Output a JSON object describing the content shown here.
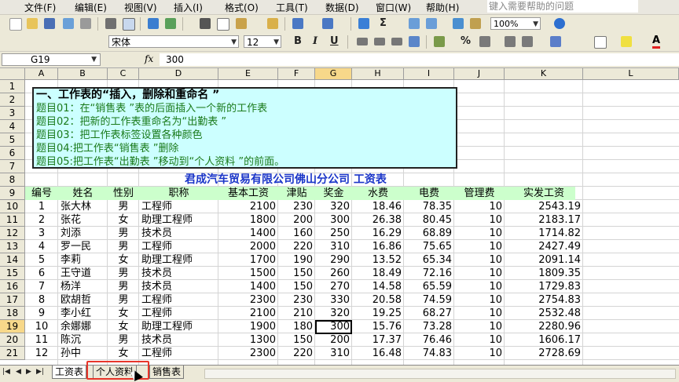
{
  "menu": [
    "文件(F)",
    "编辑(E)",
    "视图(V)",
    "插入(I)",
    "格式(O)",
    "工具(T)",
    "数据(D)",
    "窗口(W)",
    "帮助(H)"
  ],
  "help_placeholder": "键入需要帮助的问题",
  "font": {
    "name": "宋体",
    "size": "12"
  },
  "zoom": "100%",
  "formula_bar": {
    "cell_ref": "G19",
    "fx": "fx",
    "value": "300"
  },
  "columns": [
    "A",
    "B",
    "C",
    "D",
    "E",
    "F",
    "G",
    "H",
    "I",
    "J",
    "K",
    "L"
  ],
  "selected_column": "G",
  "rows": [
    "1",
    "2",
    "3",
    "4",
    "5",
    "6",
    "7",
    "8",
    "9",
    "10",
    "11",
    "12",
    "13",
    "14",
    "15",
    "16",
    "17",
    "18",
    "19",
    "20",
    "21"
  ],
  "selected_row": "19",
  "instructions": {
    "title": "一、工作表的“插入，删除和重命名 ”",
    "items": [
      "题目01：在“销售表 ”表的后面插入一个新的工作表",
      "题目02：把新的工作表重命名为“出勤表 ”",
      "题目03：把工作表标签设置各种颜色",
      "题目04:把工作表“销售表 ”删除",
      "题目05:把工作表“出勤表 ”移动到“个人资料 ”的前面。"
    ]
  },
  "company_title": "君成汽车贸易有限公司佛山分公司    工资表",
  "table_headers": [
    "编号",
    "姓名",
    "性别",
    "职称",
    "基本工资",
    "津贴",
    "奖金",
    "水费",
    "电费",
    "管理费",
    "实发工资"
  ],
  "table_rows": [
    [
      "1",
      "张大林",
      "男",
      "工程师",
      "2100",
      "230",
      "320",
      "18.46",
      "78.35",
      "10",
      "2543.19"
    ],
    [
      "2",
      "张花",
      "女",
      "助理工程师",
      "1800",
      "200",
      "300",
      "26.38",
      "80.45",
      "10",
      "2183.17"
    ],
    [
      "3",
      "刘添",
      "男",
      "技术员",
      "1400",
      "160",
      "250",
      "16.29",
      "68.89",
      "10",
      "1714.82"
    ],
    [
      "4",
      "罗一民",
      "男",
      "工程师",
      "2000",
      "220",
      "310",
      "16.86",
      "75.65",
      "10",
      "2427.49"
    ],
    [
      "5",
      "李莉",
      "女",
      "助理工程师",
      "1700",
      "190",
      "290",
      "13.52",
      "65.34",
      "10",
      "2091.14"
    ],
    [
      "6",
      "王守道",
      "男",
      "技术员",
      "1500",
      "150",
      "260",
      "18.49",
      "72.16",
      "10",
      "1809.35"
    ],
    [
      "7",
      "杨洋",
      "男",
      "技术员",
      "1400",
      "150",
      "270",
      "14.58",
      "65.59",
      "10",
      "1729.83"
    ],
    [
      "8",
      "欧胡哲",
      "男",
      "工程师",
      "2300",
      "230",
      "330",
      "20.58",
      "74.59",
      "10",
      "2754.83"
    ],
    [
      "9",
      "李小红",
      "女",
      "工程师",
      "2100",
      "210",
      "320",
      "19.25",
      "68.27",
      "10",
      "2532.48"
    ],
    [
      "10",
      "余娜娜",
      "女",
      "助理工程师",
      "1900",
      "180",
      "300",
      "15.76",
      "73.28",
      "10",
      "2280.96"
    ],
    [
      "11",
      "陈沉",
      "男",
      "技术员",
      "1300",
      "150",
      "200",
      "17.37",
      "76.46",
      "10",
      "1606.17"
    ],
    [
      "12",
      "孙中",
      "女",
      "工程师",
      "2300",
      "220",
      "310",
      "16.48",
      "74.83",
      "10",
      "2728.69"
    ]
  ],
  "sheet_tabs": [
    "工资表",
    "个人资料",
    "销售表"
  ],
  "active_tab": "工资表",
  "colors": {
    "header_band": "#ccffcc",
    "instruction_bg": "#ccffff",
    "instruction_text": "#1a7a1a",
    "company_text": "#1a35c8",
    "highlight": "#e8352a"
  }
}
